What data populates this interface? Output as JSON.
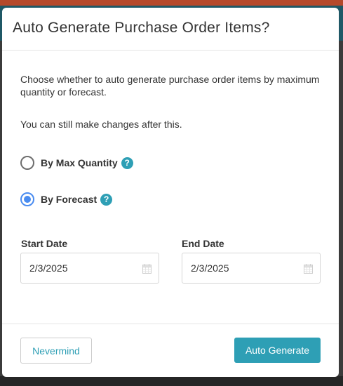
{
  "dialog": {
    "title": "Auto Generate Purchase Order Items?",
    "description": "Choose whether to auto generate purchase order items by maximum quantity or forecast.",
    "note": "You can still make changes after this."
  },
  "options": {
    "max_quantity": {
      "label": "By Max Quantity",
      "selected": false,
      "help_icon": "question-circle"
    },
    "forecast": {
      "label": "By Forecast",
      "selected": true,
      "help_icon": "question-circle"
    },
    "help_glyph": "?"
  },
  "fields": {
    "start_date": {
      "label": "Start Date",
      "value": "2/3/2025",
      "icon": "calendar-icon"
    },
    "end_date": {
      "label": "End Date",
      "value": "2/3/2025",
      "icon": "calendar-icon"
    }
  },
  "footer": {
    "nevermind_label": "Nevermind",
    "auto_generate_label": "Auto Generate"
  },
  "colors": {
    "accent": "#2e9fb5",
    "radio_selected": "#4a8cf0",
    "header_bar": "#b5492b"
  }
}
